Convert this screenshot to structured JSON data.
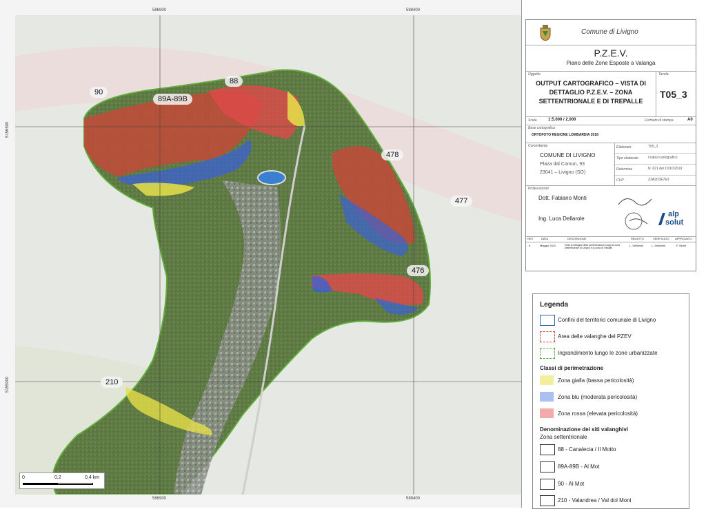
{
  "map": {
    "coords_top": [
      "586900",
      "588400"
    ],
    "coords_bottom": [
      "586900",
      "588400"
    ],
    "coords_left": [
      "5156500",
      "5155000"
    ],
    "coords_right": [
      "5156500",
      "5155000"
    ],
    "site_labels": [
      "90",
      "89A-89B",
      "88",
      "478",
      "477",
      "476",
      "210"
    ],
    "scalebar": {
      "ticks": [
        "0",
        "0,2",
        "0,4 km"
      ]
    }
  },
  "titleblock": {
    "municipality": "Comune di Livigno",
    "plan_title": "P.Z.E.V.",
    "plan_subtitle": "Piano delle Zone Esposte a Valanga",
    "oggetto_label": "Oggetto",
    "oggetto": "OUTPUT CARTOGRAFICO – VISTA DI DETTAGLIO P.Z.E.V. – ZONA SETTENTRIONALE E DI TREPALLE",
    "tavola_label": "Tavola",
    "tavola": "T05_3",
    "scala_label": "Scala",
    "scala": "1:5.000 / 2.000",
    "formato_label": "Formato di stampa",
    "formato": "A0",
    "base_label": "Base cartografica",
    "base": "ORTOFOTO REGIONE LOMBARDIA 2018",
    "committente_label": "Committente",
    "committente_name": "COMUNE DI LIVIGNO",
    "committente_addr1": "Plaza dal Comun, 93",
    "committente_addr2": "23041 – Livigno (SO)",
    "fields": [
      {
        "label": "Elaborato",
        "value": "T05_3"
      },
      {
        "label": "Tipo elaborato",
        "value": "Output cartografico"
      },
      {
        "label": "Determina",
        "value": "N. 621 del 10/10/2019"
      },
      {
        "label": "CUP",
        "value": "Z3A2D3E7E3"
      }
    ],
    "professionisti_label": "Professionisti",
    "prof1": "Dott. Fabiano Monti",
    "prof2": "Ing. Luca Dellarole",
    "logo_text_1": "alp",
    "logo_text_2": "solut",
    "rev_headers": [
      "REV",
      "DATA",
      "DESCRIZIONE",
      "REDATTO",
      "VERIFICATO",
      "APPROVATO"
    ],
    "rev_row": [
      "0",
      "Maggio 2021",
      "Vista di dettaglio della perimetrazione lungo la zona settentrionale di Livigno e la zona di Trepalle",
      "L. Dellarole",
      "L. Dellarole",
      "F. Monti"
    ]
  },
  "legend": {
    "title": "Legenda",
    "items": [
      {
        "label": "Confini del territorio comunale di Livigno"
      },
      {
        "label": "Area delle valanghe del PZEV"
      },
      {
        "label": "Ingrandimento lungo le zone urbanizzate"
      }
    ],
    "classes_title": "Classi di perimetrazione",
    "classes": [
      {
        "label": "Zona gialla (bassa pericolosità)",
        "color": "#f3ef9e"
      },
      {
        "label": "Zona blu (moderata pericolosità)",
        "color": "#a9c0f0"
      },
      {
        "label": "Zona rossa (elevata pericolosità)",
        "color": "#f3aaaa"
      }
    ],
    "sites_title": "Denominazione dei siti valanghivi",
    "sites_subtitle": "Zona settentrionale",
    "sites": [
      {
        "label": "88 - Canalecia / Il Motto"
      },
      {
        "label": "89A-89B - Al Mot"
      },
      {
        "label": "90 - Al Mot"
      },
      {
        "label": "210 - Valandrea / Val dol Moni"
      }
    ]
  },
  "colors": {
    "red_zone": "#d43b3b",
    "blue_zone": "#3b62d4",
    "yellow_zone": "#e6e04a",
    "border_green": "#5fae3a",
    "municipal_border": "#2f5fa8"
  }
}
